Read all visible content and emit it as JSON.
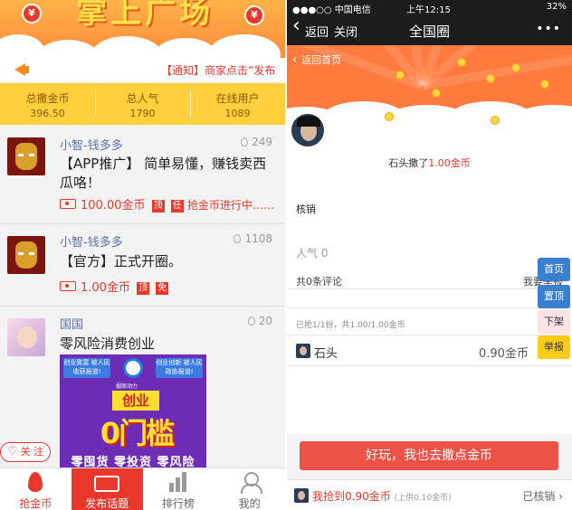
{
  "left": {
    "banner_title": "掌上广场",
    "notice": "【通知】商家点击“发布",
    "stats": [
      {
        "label": "总撒金币",
        "value": "396.50"
      },
      {
        "label": "总人气",
        "value": "1790"
      },
      {
        "label": "在线用户",
        "value": "1089"
      }
    ],
    "posts": [
      {
        "author": "小智-钱多多",
        "likes": "249",
        "text": "【APP推广】 简单易懂，赚钱卖西瓜咯！",
        "gold": "100.00金币",
        "tags": [
          "顶",
          "任"
        ],
        "progress": "抢金币进行中……"
      },
      {
        "author": "小智-钱多多",
        "likes": "1108",
        "text": "【官方】正式开圈。",
        "gold": "1.00金币",
        "tags": [
          "顶",
          "免"
        ]
      },
      {
        "author": "国国",
        "likes": "20",
        "text": "零风险消费创业"
      }
    ],
    "ad": {
      "banner_left": "创业致富 被人民收获报道!",
      "banner_right": "创业创新 被人民政协报道!",
      "brand": "掘联动力",
      "chuangye": "创业",
      "big": "0门槛",
      "bottom": "零囤货 零投资 零风险"
    },
    "follow_label": "关 注",
    "tabs": [
      {
        "label": "抢金币"
      },
      {
        "label": "发布话题"
      },
      {
        "label": "排行榜"
      },
      {
        "label": "我的"
      }
    ]
  },
  "right": {
    "status": {
      "carrier": "●●●○○ 中国电信 ",
      "time": "上午12:15",
      "battery": "32%"
    },
    "nav": {
      "back": "返回",
      "close": "关闭",
      "title": "全国圈",
      "more": "•••"
    },
    "back_home": "返回首页",
    "gift_prefix": "石头撒了",
    "gift_amount": "1.00金币",
    "nuke_label": "核销",
    "popularity": "人气 0",
    "comment_count": "共0条评论",
    "report_partial": "我要举报",
    "grab_summary": "已抢1/1份，共1.00/1.00金币",
    "grab_name": "石头",
    "grab_amount": "0.90金币",
    "side_buttons": {
      "home": "首页",
      "top": "置顶",
      "down": "下架",
      "report": "举报"
    },
    "cta": "好玩，我也去撒点金币",
    "my_grab": "我抢到0.90金币",
    "my_grab_sub": "(上供0.10金币)",
    "my_grab_status": "已核销"
  }
}
